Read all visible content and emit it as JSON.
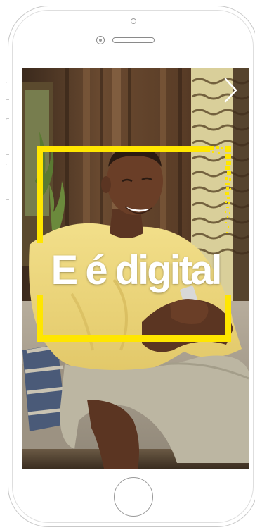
{
  "slide": {
    "headline": "E é digital"
  },
  "navigation": {
    "next_icon": "chevron-right-icon"
  },
  "colors": {
    "accent_yellow": "#ffe600",
    "headline": "#ffffff"
  }
}
